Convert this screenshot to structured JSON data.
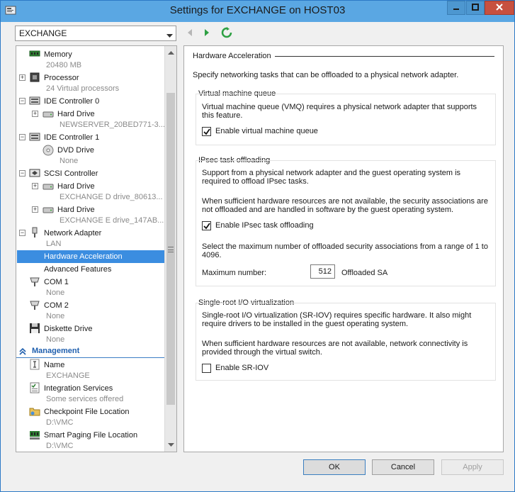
{
  "window": {
    "title": "Settings for EXCHANGE on HOST03",
    "colors": {
      "titlebar": "#5aa7e3",
      "selection": "#3b8de0",
      "close": "#c7503f"
    }
  },
  "vm_select": {
    "value": "EXCHANGE"
  },
  "tree": {
    "memory": {
      "label": "Memory",
      "sub": "20480 MB"
    },
    "processor": {
      "label": "Processor",
      "sub": "24 Virtual processors"
    },
    "ide0": {
      "label": "IDE Controller 0"
    },
    "ide0_hdd": {
      "label": "Hard Drive",
      "sub": "NEWSERVER_20BED771-3..."
    },
    "ide1": {
      "label": "IDE Controller 1"
    },
    "ide1_dvd": {
      "label": "DVD Drive",
      "sub": "None"
    },
    "scsi": {
      "label": "SCSI Controller"
    },
    "scsi_hdd1": {
      "label": "Hard Drive",
      "sub": "EXCHANGE D drive_80613..."
    },
    "scsi_hdd2": {
      "label": "Hard Drive",
      "sub": "EXCHANGE E drive_147AB..."
    },
    "netadapter": {
      "label": "Network Adapter",
      "sub": "LAN"
    },
    "hwaccel": {
      "label": "Hardware Acceleration"
    },
    "advfeatures": {
      "label": "Advanced Features"
    },
    "com1": {
      "label": "COM 1",
      "sub": "None"
    },
    "com2": {
      "label": "COM 2",
      "sub": "None"
    },
    "diskette": {
      "label": "Diskette Drive",
      "sub": "None"
    },
    "management": {
      "label": "Management"
    },
    "name": {
      "label": "Name",
      "sub": "EXCHANGE"
    },
    "integration": {
      "label": "Integration Services",
      "sub": "Some services offered"
    },
    "checkpoint": {
      "label": "Checkpoint File Location",
      "sub": "D:\\VMC"
    },
    "smartpaging": {
      "label": "Smart Paging File Location",
      "sub": "D:\\VMC"
    }
  },
  "panel": {
    "title": "Hardware Acceleration",
    "description": "Specify networking tasks that can be offloaded to a physical network adapter.",
    "vmq": {
      "title": "Virtual machine queue",
      "text": "Virtual machine queue (VMQ) requires a physical network adapter that supports this feature.",
      "checkbox_label": "Enable virtual machine queue",
      "checked": true
    },
    "ipsec": {
      "title": "IPsec task offloading",
      "text1": "Support from a physical network adapter and the guest operating system is required to offload IPsec tasks.",
      "text2": "When sufficient hardware resources are not available, the security associations are not offloaded and are handled in software by the guest operating system.",
      "checkbox_label": "Enable IPsec task offloading",
      "checked": true,
      "text3": "Select the maximum number of offloaded security associations from a range of 1 to 4096.",
      "max_label": "Maximum number:",
      "max_value": "512",
      "max_suffix": "Offloaded SA"
    },
    "sriov": {
      "title": "Single-root I/O virtualization",
      "text1": "Single-root I/O virtualization (SR-IOV) requires specific hardware. It also might require drivers to be installed in the guest operating system.",
      "text2": "When sufficient hardware resources are not available, network connectivity is provided through the virtual switch.",
      "checkbox_label": "Enable SR-IOV",
      "checked": false
    }
  },
  "buttons": {
    "ok": "OK",
    "cancel": "Cancel",
    "apply": "Apply"
  }
}
